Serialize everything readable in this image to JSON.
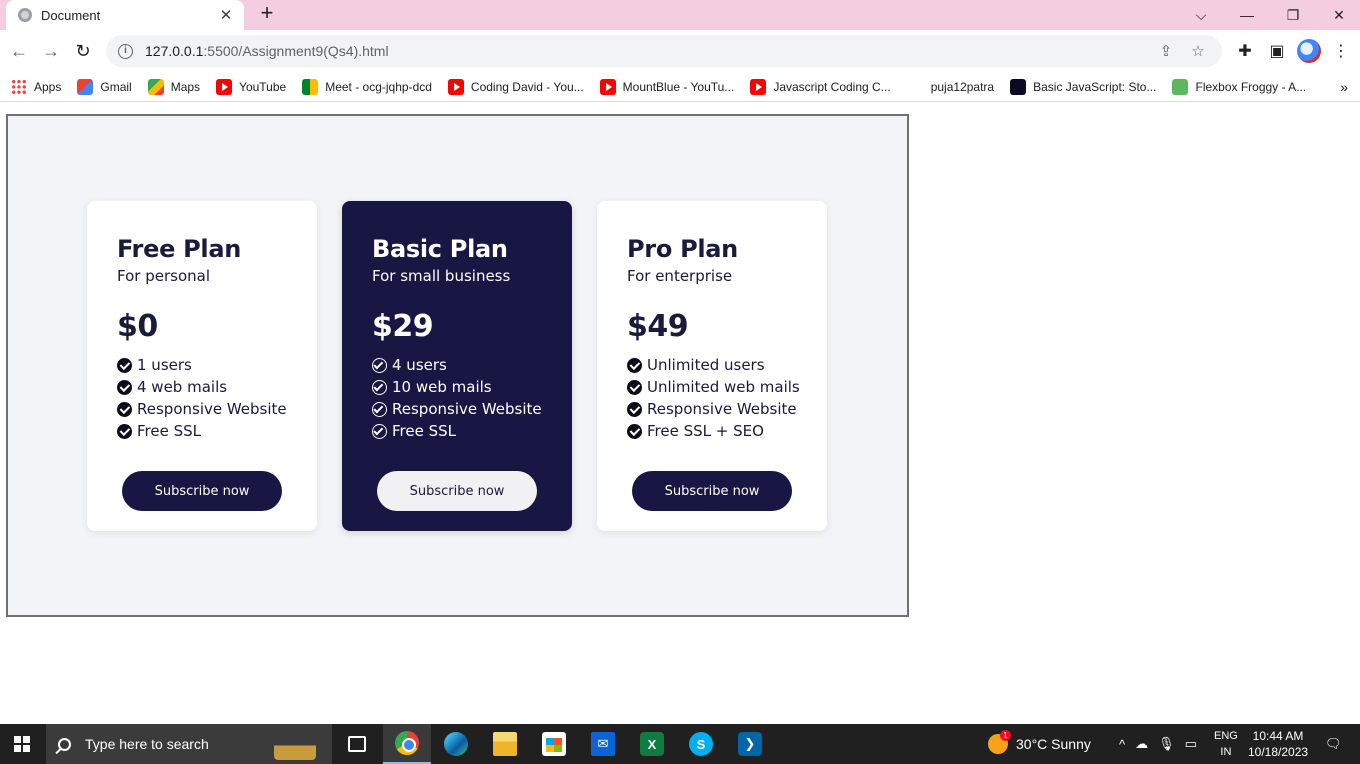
{
  "browser": {
    "tab_title": "Document",
    "tab_close": "✕",
    "new_tab": "+",
    "url_host": "127.0.0.1",
    "url_rest": ":5500/Assignment9(Qs4).html",
    "controls": {
      "tabsearch": "⌵",
      "minimize": "—",
      "restore": "❐",
      "close": "✕"
    },
    "nav": {
      "back": "←",
      "forward": "→",
      "reload": "↻"
    }
  },
  "bookmarks": [
    {
      "label": "Apps",
      "icon": "apps-grid-icon"
    },
    {
      "label": "Gmail",
      "icon": "gmail-icon"
    },
    {
      "label": "Maps",
      "icon": "maps-icon"
    },
    {
      "label": "YouTube",
      "icon": "youtube-icon"
    },
    {
      "label": "Meet - ocg-jqhp-dcd",
      "icon": "meet-icon"
    },
    {
      "label": "Coding David - You...",
      "icon": "youtube-icon"
    },
    {
      "label": "MountBlue - YouTu...",
      "icon": "youtube-icon"
    },
    {
      "label": "Javascript Coding C...",
      "icon": "youtube-icon"
    },
    {
      "label": "puja12patra",
      "icon": ""
    },
    {
      "label": "Basic JavaScript: Sto...",
      "icon": "freecodecamp-icon"
    },
    {
      "label": "Flexbox Froggy - A...",
      "icon": "froggy-icon"
    }
  ],
  "bookmarks_more": "»",
  "plans": [
    {
      "name": "Free Plan",
      "subtitle": "For personal",
      "price": "$0",
      "features": [
        "1 users",
        "4 web mails",
        "Responsive Website",
        "Free SSL"
      ],
      "button": "Subscribe now"
    },
    {
      "name": "Basic Plan",
      "subtitle": "For small business",
      "price": "$29",
      "features": [
        "4 users",
        "10 web mails",
        "Responsive Website",
        "Free SSL"
      ],
      "button": "Subscribe now"
    },
    {
      "name": "Pro Plan",
      "subtitle": "For enterprise",
      "price": "$49",
      "features": [
        "Unlimited users",
        "Unlimited web mails",
        "Responsive Website",
        "Free SSL + SEO"
      ],
      "button": "Subscribe now"
    }
  ],
  "taskbar": {
    "search_placeholder": "Type here to search",
    "weather": "30°C  Sunny",
    "weather_badge": "1",
    "lang_top": "ENG",
    "lang_bottom": "IN",
    "time": "10:44 AM",
    "date": "10/18/2023"
  },
  "colors": {
    "accent_navy": "#181744",
    "title_bar": "#f4cde0",
    "stage_bg": "#f2f4f7"
  }
}
